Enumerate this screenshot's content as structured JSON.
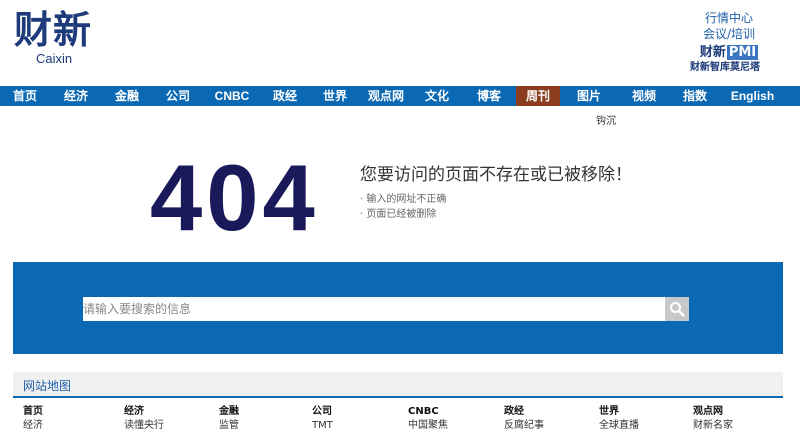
{
  "logo": {
    "cn": "财新",
    "en": "Caixin"
  },
  "top_links": [
    "行情中心",
    "会议/培训"
  ],
  "pmi": {
    "brand": "财新",
    "badge": "PMI",
    "sub": "财新智库莫尼塔"
  },
  "nav": [
    {
      "label": "首页",
      "w": 50
    },
    {
      "label": "经济",
      "w": 52
    },
    {
      "label": "金融",
      "w": 50
    },
    {
      "label": "公司",
      "w": 52
    },
    {
      "label": "CNBC",
      "w": 56
    },
    {
      "label": "政经",
      "w": 50
    },
    {
      "label": "世界",
      "w": 50
    },
    {
      "label": "观点网",
      "w": 52
    },
    {
      "label": "文化",
      "w": 50
    },
    {
      "label": "博客",
      "w": 54
    },
    {
      "label": "周刊",
      "w": 44,
      "active": true
    },
    {
      "label": "图片",
      "w": 58
    },
    {
      "label": "视频",
      "w": 52
    },
    {
      "label": "指数",
      "w": 50
    },
    {
      "label": "English",
      "w": 65
    }
  ],
  "subnav_item": "钩沉",
  "error": {
    "code": "404",
    "title": "您要访问的页面不存在或已被移除！",
    "reasons": [
      "输入的网址不正确",
      "页面已经被删除"
    ]
  },
  "search": {
    "placeholder": "请输入要搜索的信息",
    "icon": "search-icon"
  },
  "sitemap": {
    "title": "网站地图",
    "columns": [
      {
        "head": "首页",
        "link": "经济"
      },
      {
        "head": "经济",
        "link": "读懂央行"
      },
      {
        "head": "金融",
        "link": "监管"
      },
      {
        "head": "公司",
        "link": "TMT"
      },
      {
        "head": "CNBC",
        "link": "中国聚焦"
      },
      {
        "head": "政经",
        "link": "反腐纪事"
      },
      {
        "head": "世界",
        "link": "全球直播"
      },
      {
        "head": "观点网",
        "link": "财新名家"
      }
    ]
  },
  "colors": {
    "brand_blue": "#0b68b3",
    "active_tab": "#8b3d1f",
    "error_code": "#1a1a5a"
  }
}
